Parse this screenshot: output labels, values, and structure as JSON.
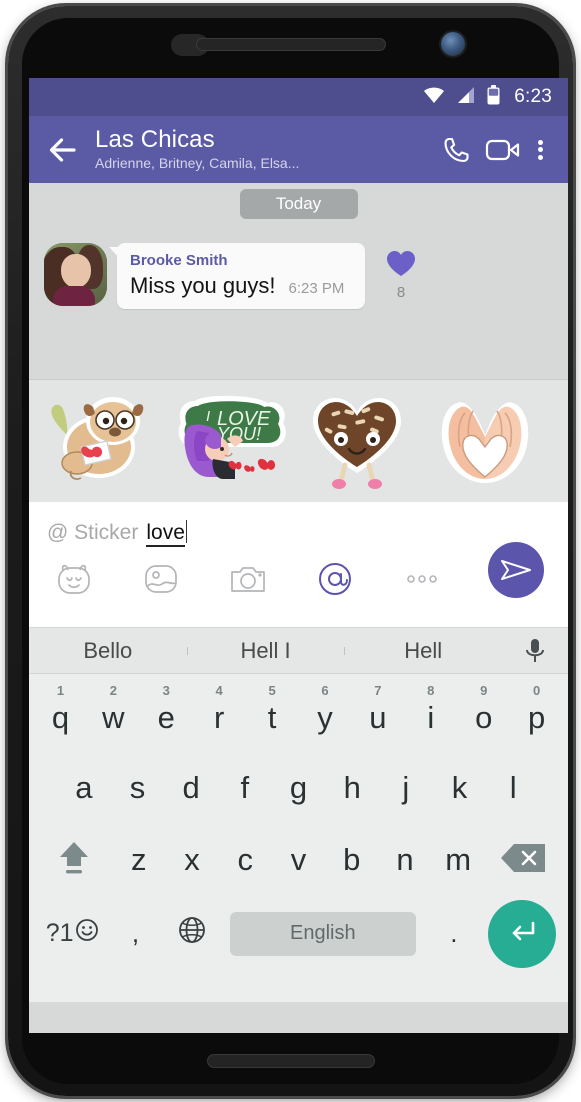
{
  "status_bar": {
    "time": "6:23",
    "icons": [
      "wifi-icon",
      "cellular-signal-icon",
      "battery-icon"
    ],
    "background": "#4e4e8f"
  },
  "toolbar": {
    "background": "#5b5ba5",
    "back_icon": "back-arrow-icon",
    "title": "Las Chicas",
    "subtitle": "Adrienne, Britney, Camila, Elsa...",
    "actions": [
      "phone-call-icon",
      "video-call-icon",
      "overflow-menu-icon"
    ]
  },
  "conversation": {
    "date_chip": "Today",
    "message": {
      "sender": "Brooke Smith",
      "text": "Miss you guys!",
      "time": "6:23 PM",
      "avatar": "brooke-smith-avatar",
      "reaction": {
        "icon": "heart-icon",
        "color": "#6c5fc7",
        "count": "8"
      }
    }
  },
  "sticker_strip": {
    "stickers": [
      {
        "name": "pug-with-love-letter-sticker",
        "alt": "pug holding heart envelope"
      },
      {
        "name": "i-love-you-chalkboard-sticker",
        "alt": "I LOVE YOU!"
      },
      {
        "name": "chocolate-heart-sticker",
        "alt": "smiling chocolate heart"
      },
      {
        "name": "hands-heart-sticker",
        "alt": "hands forming a heart"
      }
    ]
  },
  "input_area": {
    "prefix": "@ Sticker",
    "value": "love",
    "tools": [
      "sticker-icon",
      "gallery-icon",
      "camera-icon",
      "mention-icon",
      "more-options-icon"
    ],
    "active_tool": "mention-icon",
    "active_tool_color": "#5b55ab",
    "send_icon": "send-icon",
    "send_color": "#5b55ab"
  },
  "keyboard": {
    "suggestions": [
      "Bello",
      "Hell I",
      "Hell"
    ],
    "mic_icon": "microphone-icon",
    "row1": [
      {
        "key": "q",
        "hint": "1"
      },
      {
        "key": "w",
        "hint": "2"
      },
      {
        "key": "e",
        "hint": "3"
      },
      {
        "key": "r",
        "hint": "4"
      },
      {
        "key": "t",
        "hint": "5"
      },
      {
        "key": "y",
        "hint": "6"
      },
      {
        "key": "u",
        "hint": "7"
      },
      {
        "key": "i",
        "hint": "8"
      },
      {
        "key": "o",
        "hint": "9"
      },
      {
        "key": "p",
        "hint": "0"
      }
    ],
    "row2": [
      "a",
      "s",
      "d",
      "f",
      "g",
      "h",
      "j",
      "k",
      "l"
    ],
    "row3": [
      "z",
      "x",
      "c",
      "v",
      "b",
      "n",
      "m"
    ],
    "shift_icon": "shift-icon",
    "backspace_icon": "backspace-icon",
    "symbols_label": "?1",
    "symbols_emoji_icon": "emoji-icon",
    "comma_label": ",",
    "language_icon": "globe-icon",
    "space_label": "English",
    "period_label": ".",
    "enter_icon": "enter-icon",
    "enter_color": "#26ad94"
  }
}
